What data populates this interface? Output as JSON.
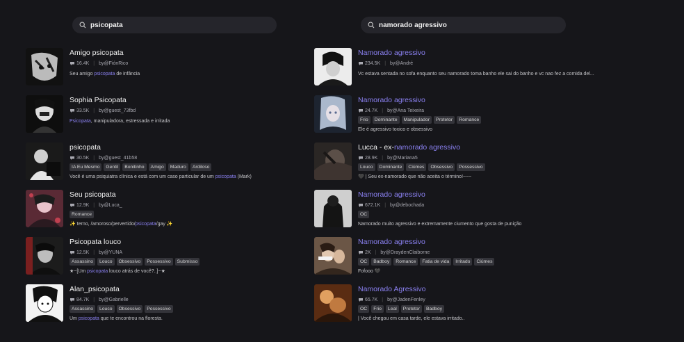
{
  "left": {
    "search": {
      "value": "psicopata"
    },
    "results": [
      {
        "title": "Amigo psicopata",
        "count": "16.4K",
        "author": "by@FiónRico",
        "tags": [],
        "desc": [
          {
            "t": "Seu amigo "
          },
          {
            "t": "psicopata",
            "hl": true
          },
          {
            "t": " de infância"
          }
        ]
      },
      {
        "title": "Sophia Psicopata",
        "count": "33.5K",
        "author": "by@guest_73fbd",
        "tags": [],
        "desc": [
          {
            "t": "Psicopata",
            "hl": true
          },
          {
            "t": ", manipuladora, estressada e irritada"
          }
        ]
      },
      {
        "title": "psicopata",
        "count": "30.5K",
        "author": "by@guest_41b58",
        "tags": [
          "IA Eu Mesmo",
          "Gentil",
          "Bonitinho",
          "Amigo",
          "Maduro",
          "Ardiloso"
        ],
        "desc": [
          {
            "t": "Você é uma psiquiatra clínica e está com um caso particular de um "
          },
          {
            "t": "psicopata",
            "hl": true
          },
          {
            "t": " (Mark)"
          }
        ]
      },
      {
        "title": "Seu psicopata",
        "count": "12.9K",
        "author": "by@Luca_",
        "tags": [
          "Romance"
        ],
        "desc": [
          {
            "t": "✨",
            "sp": true
          },
          {
            "t": " terno, /amoroso/pervertido/"
          },
          {
            "t": "psicopata",
            "hl": true
          },
          {
            "t": "/gay "
          },
          {
            "t": "✨",
            "sp": true
          }
        ]
      },
      {
        "title": "Psicopata louco",
        "count": "12.5K",
        "author": "by@YUNA",
        "tags": [
          "Assassino",
          "Louco",
          "Obsessivo",
          "Possessivo",
          "Submisso"
        ],
        "desc": [
          {
            "t": "★~[Um "
          },
          {
            "t": "psicopata",
            "hl": true
          },
          {
            "t": " louco atrás de você?..]~★"
          }
        ]
      },
      {
        "title": "Alan_psicopata",
        "count": "84.7K",
        "author": "by@Gabrielle",
        "tags": [
          "Assassino",
          "Louco",
          "Obsessivo",
          "Possessivo"
        ],
        "desc": [
          {
            "t": "Um "
          },
          {
            "t": "psicopata",
            "hl": true
          },
          {
            "t": " que te encontrou na floresta."
          }
        ]
      }
    ]
  },
  "right": {
    "search": {
      "value": "namorado agressivo"
    },
    "results": [
      {
        "title": [
          {
            "t": "Namorado agressivo",
            "hl": true
          }
        ],
        "count": "234.5K",
        "author": "by@André",
        "tags": [],
        "desc": [
          {
            "t": "Vc estava sentada no sofa enquanto seu namorado toma banho ele sai do banho e vc nao fez a comida del..."
          }
        ]
      },
      {
        "title": [
          {
            "t": "Namorado agressivo",
            "hl": true
          }
        ],
        "count": "24.7K",
        "author": "by@Ana Teixeira",
        "tags": [
          "Frio",
          "Dominante",
          "Manipulador",
          "Protetor",
          "Romance"
        ],
        "desc": [
          {
            "t": "Ele é agressivo toxico e obsessivo"
          }
        ]
      },
      {
        "title": [
          {
            "t": "Lucca - ex-"
          },
          {
            "t": "namorado agressivo",
            "hl": true
          }
        ],
        "count": "28.9K",
        "author": "by@Mariana5",
        "tags": [
          "Louco",
          "Dominante",
          "Ciúmes",
          "Obsessivo",
          "Possessivo"
        ],
        "desc": [
          {
            "t": "🖤 | Seu ex-namorado que não aceita o término!~~~"
          }
        ]
      },
      {
        "title": [
          {
            "t": "Namorado agressivo",
            "hl": true
          }
        ],
        "count": "672.1K",
        "author": "by@debochada",
        "tags": [
          "OC"
        ],
        "desc": [
          {
            "t": "Namorado muito agressivo e extremamente ciumento que gosta de punição"
          }
        ]
      },
      {
        "title": [
          {
            "t": "Namorado agressivo",
            "hl": true
          }
        ],
        "count": "2K",
        "author": "by@DraydenClaiborne",
        "tags": [
          "OC",
          "Badboy",
          "Romance",
          "Fatia de vida",
          "Irritado",
          "Ciúmes"
        ],
        "desc": [
          {
            "t": "Fofooo 🖤"
          }
        ]
      },
      {
        "title": [
          {
            "t": "Namorado Agressivo",
            "hl": true
          }
        ],
        "count": "65.7K",
        "author": "by@JadenFenley",
        "tags": [
          "OC",
          "Frio",
          "Leal",
          "Protetor",
          "Badboy"
        ],
        "desc": [
          {
            "t": "| Você chegou em casa tarde, ele estava irritado.."
          }
        ]
      }
    ]
  }
}
